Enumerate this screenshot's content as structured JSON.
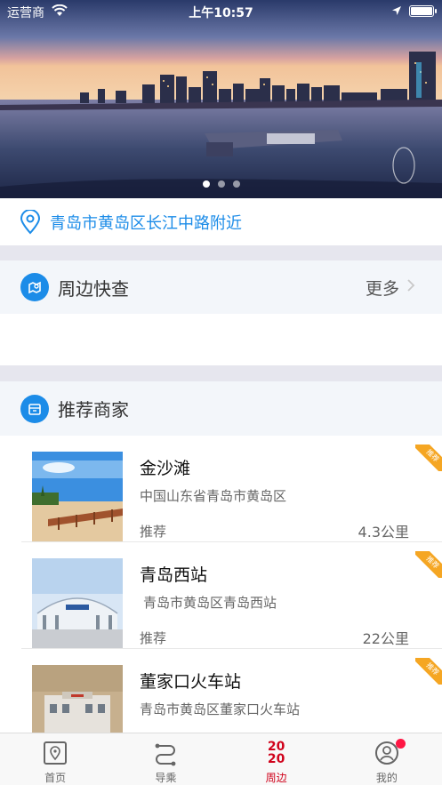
{
  "status_bar": {
    "carrier": "运营商",
    "time": "上午10:57"
  },
  "banner": {
    "page_count": 3,
    "active_page": 0
  },
  "location": {
    "text": "青岛市黄岛区长江中路附近"
  },
  "nearby": {
    "title": "周边快查",
    "more_label": "更多"
  },
  "recommended": {
    "title": "推荐商家"
  },
  "merchants": [
    {
      "name": "金沙滩",
      "address": "中国山东省青岛市黄岛区",
      "tag": "推荐",
      "distance": "4.3公里",
      "ribbon": "推荐"
    },
    {
      "name": "青岛西站",
      "address": "青岛市黄岛区青岛西站",
      "tag": "推荐",
      "distance": "22公里",
      "ribbon": "推荐"
    },
    {
      "name": "董家口火车站",
      "address": "青岛市黄岛区董家口火车站",
      "tag": "",
      "distance": "",
      "ribbon": "推荐"
    }
  ],
  "tabbar": {
    "items": [
      {
        "label": "首页",
        "icon": "map-pin-icon"
      },
      {
        "label": "导乘",
        "icon": "route-icon"
      },
      {
        "label": "周边",
        "icon": "2020-icon",
        "badge_text": "2020"
      },
      {
        "label": "我的",
        "icon": "user-icon"
      }
    ],
    "active_index": 2
  },
  "colors": {
    "accent": "#1c8ce8",
    "active_tab": "#d0021b",
    "ribbon": "#f5a623",
    "badge": "#ff1744"
  }
}
